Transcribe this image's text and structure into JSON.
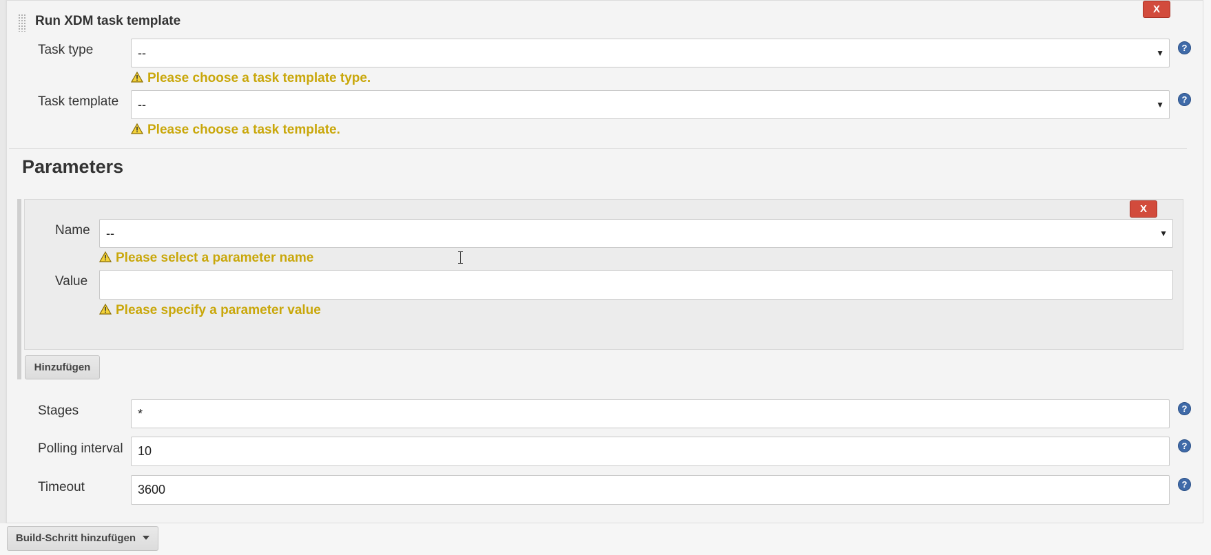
{
  "builder": {
    "title": "Run XDM task template",
    "remove_label": "X",
    "task_type": {
      "label": "Task type",
      "value": "--",
      "warning": "Please choose a task template type."
    },
    "task_template": {
      "label": "Task template",
      "value": "--",
      "warning": "Please choose a task template."
    }
  },
  "parameters": {
    "title": "Parameters",
    "remove_label": "X",
    "name": {
      "label": "Name",
      "value": "--",
      "warning": "Please select a parameter name"
    },
    "value": {
      "label": "Value",
      "value": "",
      "warning": "Please specify a parameter value"
    },
    "add_label": "Hinzufügen"
  },
  "stages": {
    "label": "Stages",
    "value": "*"
  },
  "polling_interval": {
    "label": "Polling interval",
    "value": "10"
  },
  "timeout": {
    "label": "Timeout",
    "value": "3600"
  },
  "add_build_step_label": "Build-Schritt hinzufügen",
  "icons": {
    "help": "question-circle-icon",
    "warning": "warning-triangle-icon",
    "dropdown": "chevron-down-icon"
  },
  "colors": {
    "warning_text": "#c9a70a",
    "remove_button": "#d24b3c",
    "help_icon": "#3f6aa8"
  }
}
